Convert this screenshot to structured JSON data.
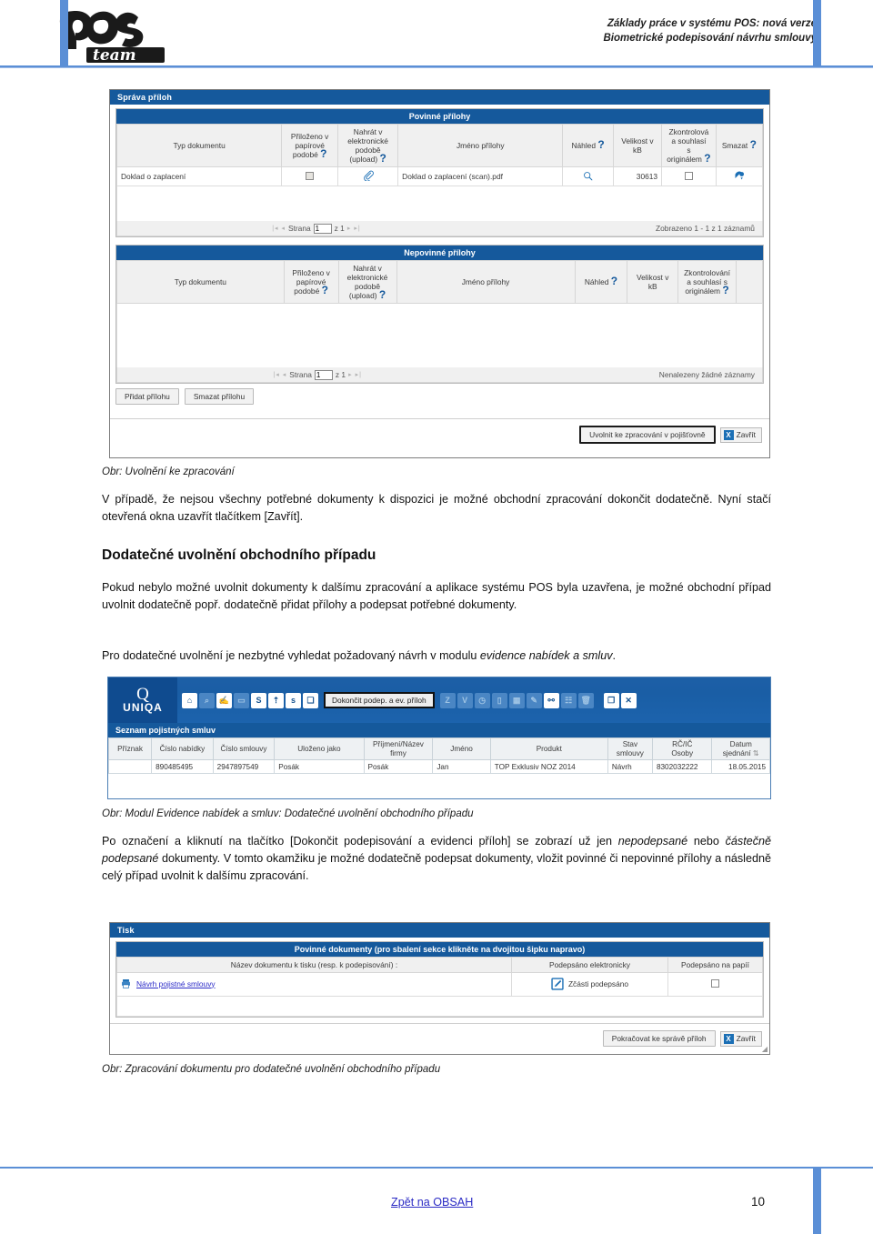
{
  "header": {
    "brand_logo_text": "POS team",
    "line1": "Základy práce v systému POS: nová verze",
    "line2": "Biometrické podepisování návrhu smlouvy"
  },
  "shot1": {
    "title": "Správa příloh",
    "section1": {
      "title": "Povinné přílohy",
      "columns": [
        "Typ dokumentu",
        "Přiloženo v papírové podobě",
        "Nahrát v elektronické podobě (upload)",
        "Jméno přílohy",
        "Náhled",
        "Velikost v kB",
        "Zkontrolová a souhlasí s originálem",
        "Smazat"
      ],
      "rows": [
        {
          "typ": "Doklad o zaplacení",
          "papir_checked": false,
          "upload_icon": "paperclip-icon",
          "jmeno": "Doklad o zaplacení (scan).pdf",
          "nahled_icon": "magnifier-icon",
          "velikost": "30613",
          "zkontrolovano_checked": false,
          "smazat_icon": "delete-icon"
        }
      ],
      "pager": {
        "label": "Strana",
        "value": "1",
        "of": "z 1",
        "status": "Zobrazeno 1 - 1 z 1 záznamů"
      }
    },
    "section2": {
      "title": "Nepovinné přílohy",
      "columns": [
        "Typ dokumentu",
        "Přiloženo v papírové podobě",
        "Nahrát v elektronické podobě (upload)",
        "Jméno přílohy",
        "Náhled",
        "Velikost v kB",
        "Zkontrolování a souhlasí s originálem"
      ],
      "rows": [],
      "pager": {
        "label": "Strana",
        "value": "1",
        "of": "z 1",
        "status": "Nenalezeny žádné záznamy"
      }
    },
    "buttons": {
      "add": "Přidat přílohu",
      "delete": "Smazat přílohu"
    },
    "footer": {
      "release": "Uvolnit ke zpracování v pojišťovně",
      "close": "Zavřít",
      "close_icon": "X"
    }
  },
  "caption1": "Obr: Uvolnění ke zpracování",
  "para1": "V případě, že nejsou všechny potřebné dokumenty k dispozici je možné obchodní zpracování dokončit dodatečně. Nyní stačí otevřená okna uzavřít tlačítkem [Zavřít].",
  "heading1": "Dodatečné uvolnění obchodního případu",
  "para2_a": "Pokud nebylo možné uvolnit dokumenty k dalšímu zpracování a aplikace systému POS byla uzavřena, je možné obchodní případ uvolnit dodatečně popř. dodatečně přidat přílohy a podepsat potřebné dokumenty.",
  "para2_b_pre": "Pro dodatečné uvolnění je nezbytné vyhledat požadovaný návrh v modulu ",
  "para2_b_em": "evidence nabídek a smluv",
  "para2_b_post": ".",
  "shot2": {
    "brand": "UNIQA",
    "toolbar_icons": [
      "home-icon",
      "search-icon",
      "hand-card-icon",
      "folder-icon",
      "s-badge-icon",
      "upload-box-icon",
      "s-box-icon",
      "copy-box-icon"
    ],
    "toolbar_button": "Dokončit podep. a ev. příloh",
    "toolbar_icons_right": [
      "z-badge-icon",
      "v-badge-icon",
      "clock-icon",
      "lock-icon",
      "chart-icon",
      "pencil-icon",
      "binoculars-icon",
      "person-card-icon",
      "trash-icon"
    ],
    "toolbar_icons_far": [
      "window-icon",
      "close-icon"
    ],
    "panel_title": "Seznam pojistných smluv",
    "columns": [
      "Příznak",
      "Číslo nabídky",
      "Číslo smlouvy",
      "Uloženo jako",
      "Příjmení/Název firmy",
      "Jméno",
      "Produkt",
      "Stav smlouvy",
      "RČ/IČ Osoby",
      "Datum sjednání"
    ],
    "rows": [
      {
        "priznak": "",
        "cislo_nabidky": "890485495",
        "cislo_smlouvy": "2947897549",
        "ulozeno_jako": "Posák",
        "prijmeni": "Posák",
        "jmeno": "Jan",
        "produkt": "TOP Exklusiv NOZ 2014",
        "stav": "Návrh",
        "rc": "8302032222",
        "datum": "18.05.2015"
      }
    ]
  },
  "caption2": "Obr: Modul Evidence nabídek a smluv: Dodatečné uvolnění obchodního případu",
  "para3_1": "Po označení a kliknutí na tlačítko [Dokončit podepisování a evidenci příloh] se zobrazí už jen ",
  "para3_em1": "nepodepsané",
  "para3_2": " nebo ",
  "para3_em2": "částečně podepsané",
  "para3_3": " dokumenty. V tomto okamžiku je možné dodatečně podepsat dokumenty, vložit povinné či nepovinné přílohy a následně celý případ uvolnit k dalšímu zpracování.",
  "shot3": {
    "title": "Tisk",
    "section_title": "Povinné dokumenty (pro sbalení sekce klikněte na dvojitou šipku napravo)",
    "columns": [
      "Název dokumentu k tisku (resp. k podepisování) :",
      "Podepsáno elektronicky",
      "Podepsáno na papíí"
    ],
    "rows": [
      {
        "doc_icon": "printer-icon",
        "name": "Návrh pojistné smlouvy",
        "sign_icon": "sign-pen-icon",
        "sign_status": "Zčásti podepsáno",
        "paper_checked": false
      }
    ],
    "footer": {
      "continue": "Pokračovat ke správě příloh",
      "close": "Zavřít",
      "close_icon": "X"
    }
  },
  "caption3": "Obr: Zpracování dokumentu pro dodatečné uvolnění obchodního případu",
  "footer": {
    "link": "Zpět na OBSAH",
    "page": "10"
  },
  "colors": {
    "accent_blue": "#5b8fd6",
    "title_blue": "#15599c",
    "link_blue": "#2b2bc4",
    "icon_blue": "#1b6fb5"
  }
}
